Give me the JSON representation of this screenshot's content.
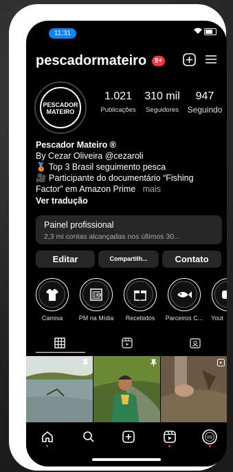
{
  "status": {
    "time": "11:31"
  },
  "header": {
    "username": "pescadormateiro",
    "notif_badge": "9+"
  },
  "profile": {
    "avatar_text_1": "PESCADOR",
    "avatar_text_2": "MATEIRO",
    "stats": [
      {
        "value": "1.021",
        "label": "Publicações"
      },
      {
        "value": "310 mil",
        "label": "Seguidores"
      },
      {
        "value": "947",
        "label": "Seguindo"
      }
    ],
    "name": "Pescador Mateiro ®",
    "bio_line1": "By Cezar Oliveira @cezaroli",
    "bio_line2": "🥉 Top 3 Brasil seguimento pesca",
    "bio_line3": "🎥 Participante do documentário “Fishing",
    "bio_line4": "Factor” em Amazon Prime",
    "more": "mais",
    "translate": "Ver tradução"
  },
  "painel": {
    "title": "Painel profissional",
    "subtitle": "2,3 mi contas alcançadas nos últimos 30..."
  },
  "buttons": {
    "edit": "Editar",
    "share": "Compartilh...",
    "contact": "Contato"
  },
  "highlights": [
    {
      "label": "Camisa",
      "icon": "tshirt-icon"
    },
    {
      "label": "PM na Mídia",
      "icon": "newspaper-icon"
    },
    {
      "label": "Recebidos",
      "icon": "gift-icon"
    },
    {
      "label": "Parceiros C...",
      "icon": "fish-icon"
    },
    {
      "label": "Yout",
      "icon": "play-icon"
    }
  ],
  "colors": {
    "accent": "#ff3040",
    "time_pill": "#0a84ff",
    "card": "#262626"
  }
}
